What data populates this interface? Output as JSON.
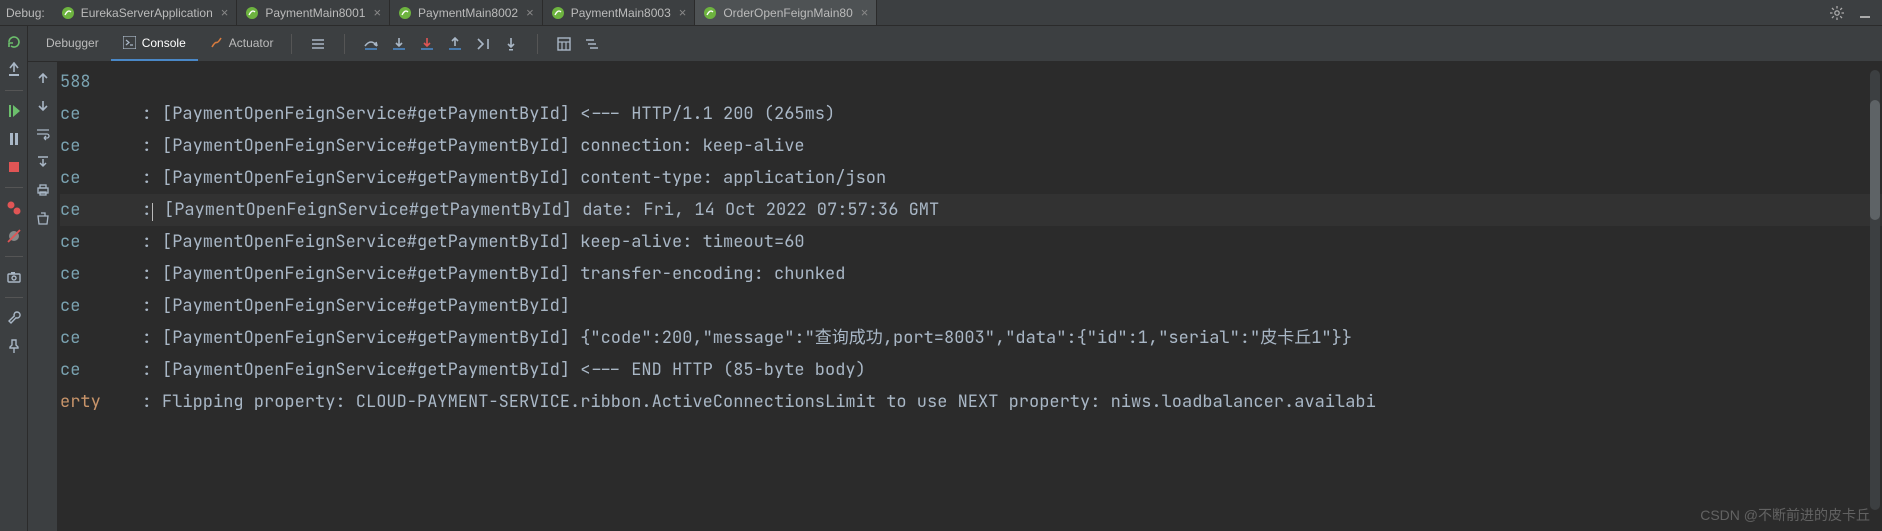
{
  "header": {
    "label": "Debug:",
    "tabs": [
      {
        "name": "EurekaServerApplication",
        "active": false
      },
      {
        "name": "PaymentMain8001",
        "active": false
      },
      {
        "name": "PaymentMain8002",
        "active": false
      },
      {
        "name": "PaymentMain8003",
        "active": false
      },
      {
        "name": "OrderOpenFeignMain80",
        "active": true
      }
    ]
  },
  "subtabs": {
    "debugger": "Debugger",
    "console": "Console",
    "actuator": "Actuator"
  },
  "console": {
    "lines": [
      {
        "lvl": "588",
        "text": ""
      },
      {
        "lvl": "ce",
        "text": "      : [PaymentOpenFeignService#getPaymentById] <--- HTTP/1.1 200 (265ms)"
      },
      {
        "lvl": "ce",
        "text": "      : [PaymentOpenFeignService#getPaymentById] connection: keep-alive"
      },
      {
        "lvl": "ce",
        "text": "      : [PaymentOpenFeignService#getPaymentById] content-type: application/json"
      },
      {
        "lvl": "ce",
        "text": "      :",
        "caret": true,
        "text2": " [PaymentOpenFeignService#getPaymentById] date: Fri, 14 Oct 2022 07:57:36 GMT"
      },
      {
        "lvl": "ce",
        "text": "      : [PaymentOpenFeignService#getPaymentById] keep-alive: timeout=60"
      },
      {
        "lvl": "ce",
        "text": "      : [PaymentOpenFeignService#getPaymentById] transfer-encoding: chunked"
      },
      {
        "lvl": "ce",
        "text": "      : [PaymentOpenFeignService#getPaymentById] "
      },
      {
        "lvl": "ce",
        "text": "      : [PaymentOpenFeignService#getPaymentById] {\"code\":200,\"message\":\"查询成功,port=8003\",\"data\":{\"id\":1,\"serial\":\"皮卡丘1\"}}"
      },
      {
        "lvl": "ce",
        "text": "      : [PaymentOpenFeignService#getPaymentById] <--- END HTTP (85-byte body)"
      },
      {
        "lvl": "erty",
        "text": "    : Flipping property: CLOUD-PAYMENT-SERVICE.ribbon.ActiveConnectionsLimit to use NEXT property: niws.loadbalancer.availabi"
      }
    ]
  },
  "watermark": "CSDN @不断前进的皮卡丘"
}
